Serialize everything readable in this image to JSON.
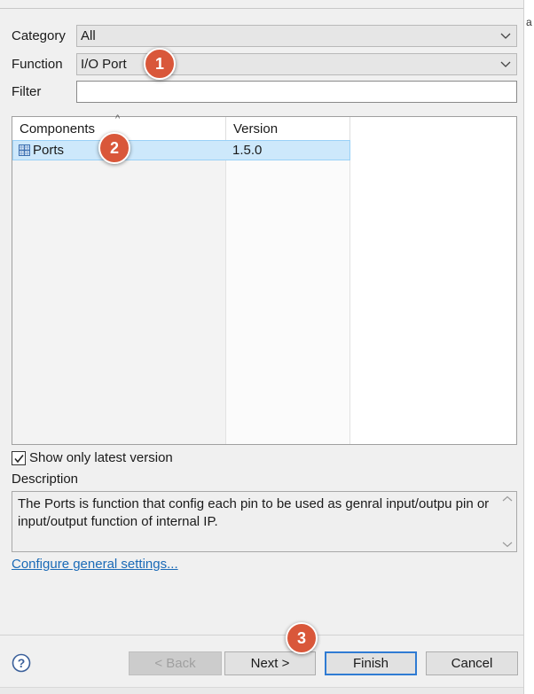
{
  "form": {
    "category_label": "Category",
    "category_value": "All",
    "function_label": "Function",
    "function_value": "I/O Port",
    "filter_label": "Filter",
    "filter_value": ""
  },
  "table": {
    "headers": [
      "Components",
      "Version"
    ],
    "sorted_column": "Components",
    "rows": [
      {
        "name": "Ports",
        "version": "1.5.0",
        "selected": true
      }
    ]
  },
  "options": {
    "show_latest_label": "Show only latest version",
    "show_latest_checked": true
  },
  "description": {
    "label": "Description",
    "text": "The Ports is function that config each pin to be used as genral input/outpu pin or input/output function of internal IP."
  },
  "link_label": "Configure general settings...",
  "buttons": {
    "back": "< Back",
    "next": "Next >",
    "finish": "Finish",
    "cancel": "Cancel"
  },
  "badges": [
    "1",
    "2",
    "3"
  ],
  "colors": {
    "badge": "#d9573a",
    "selection": "#cde8fb",
    "link": "#1a6ab7",
    "focus": "#2f7bd3"
  },
  "icons": [
    "chevron-down-icon",
    "expand-plus-icon",
    "checkmark-icon",
    "help-icon",
    "scroll-up-icon",
    "scroll-down-icon",
    "sort-ascending-icon"
  ]
}
